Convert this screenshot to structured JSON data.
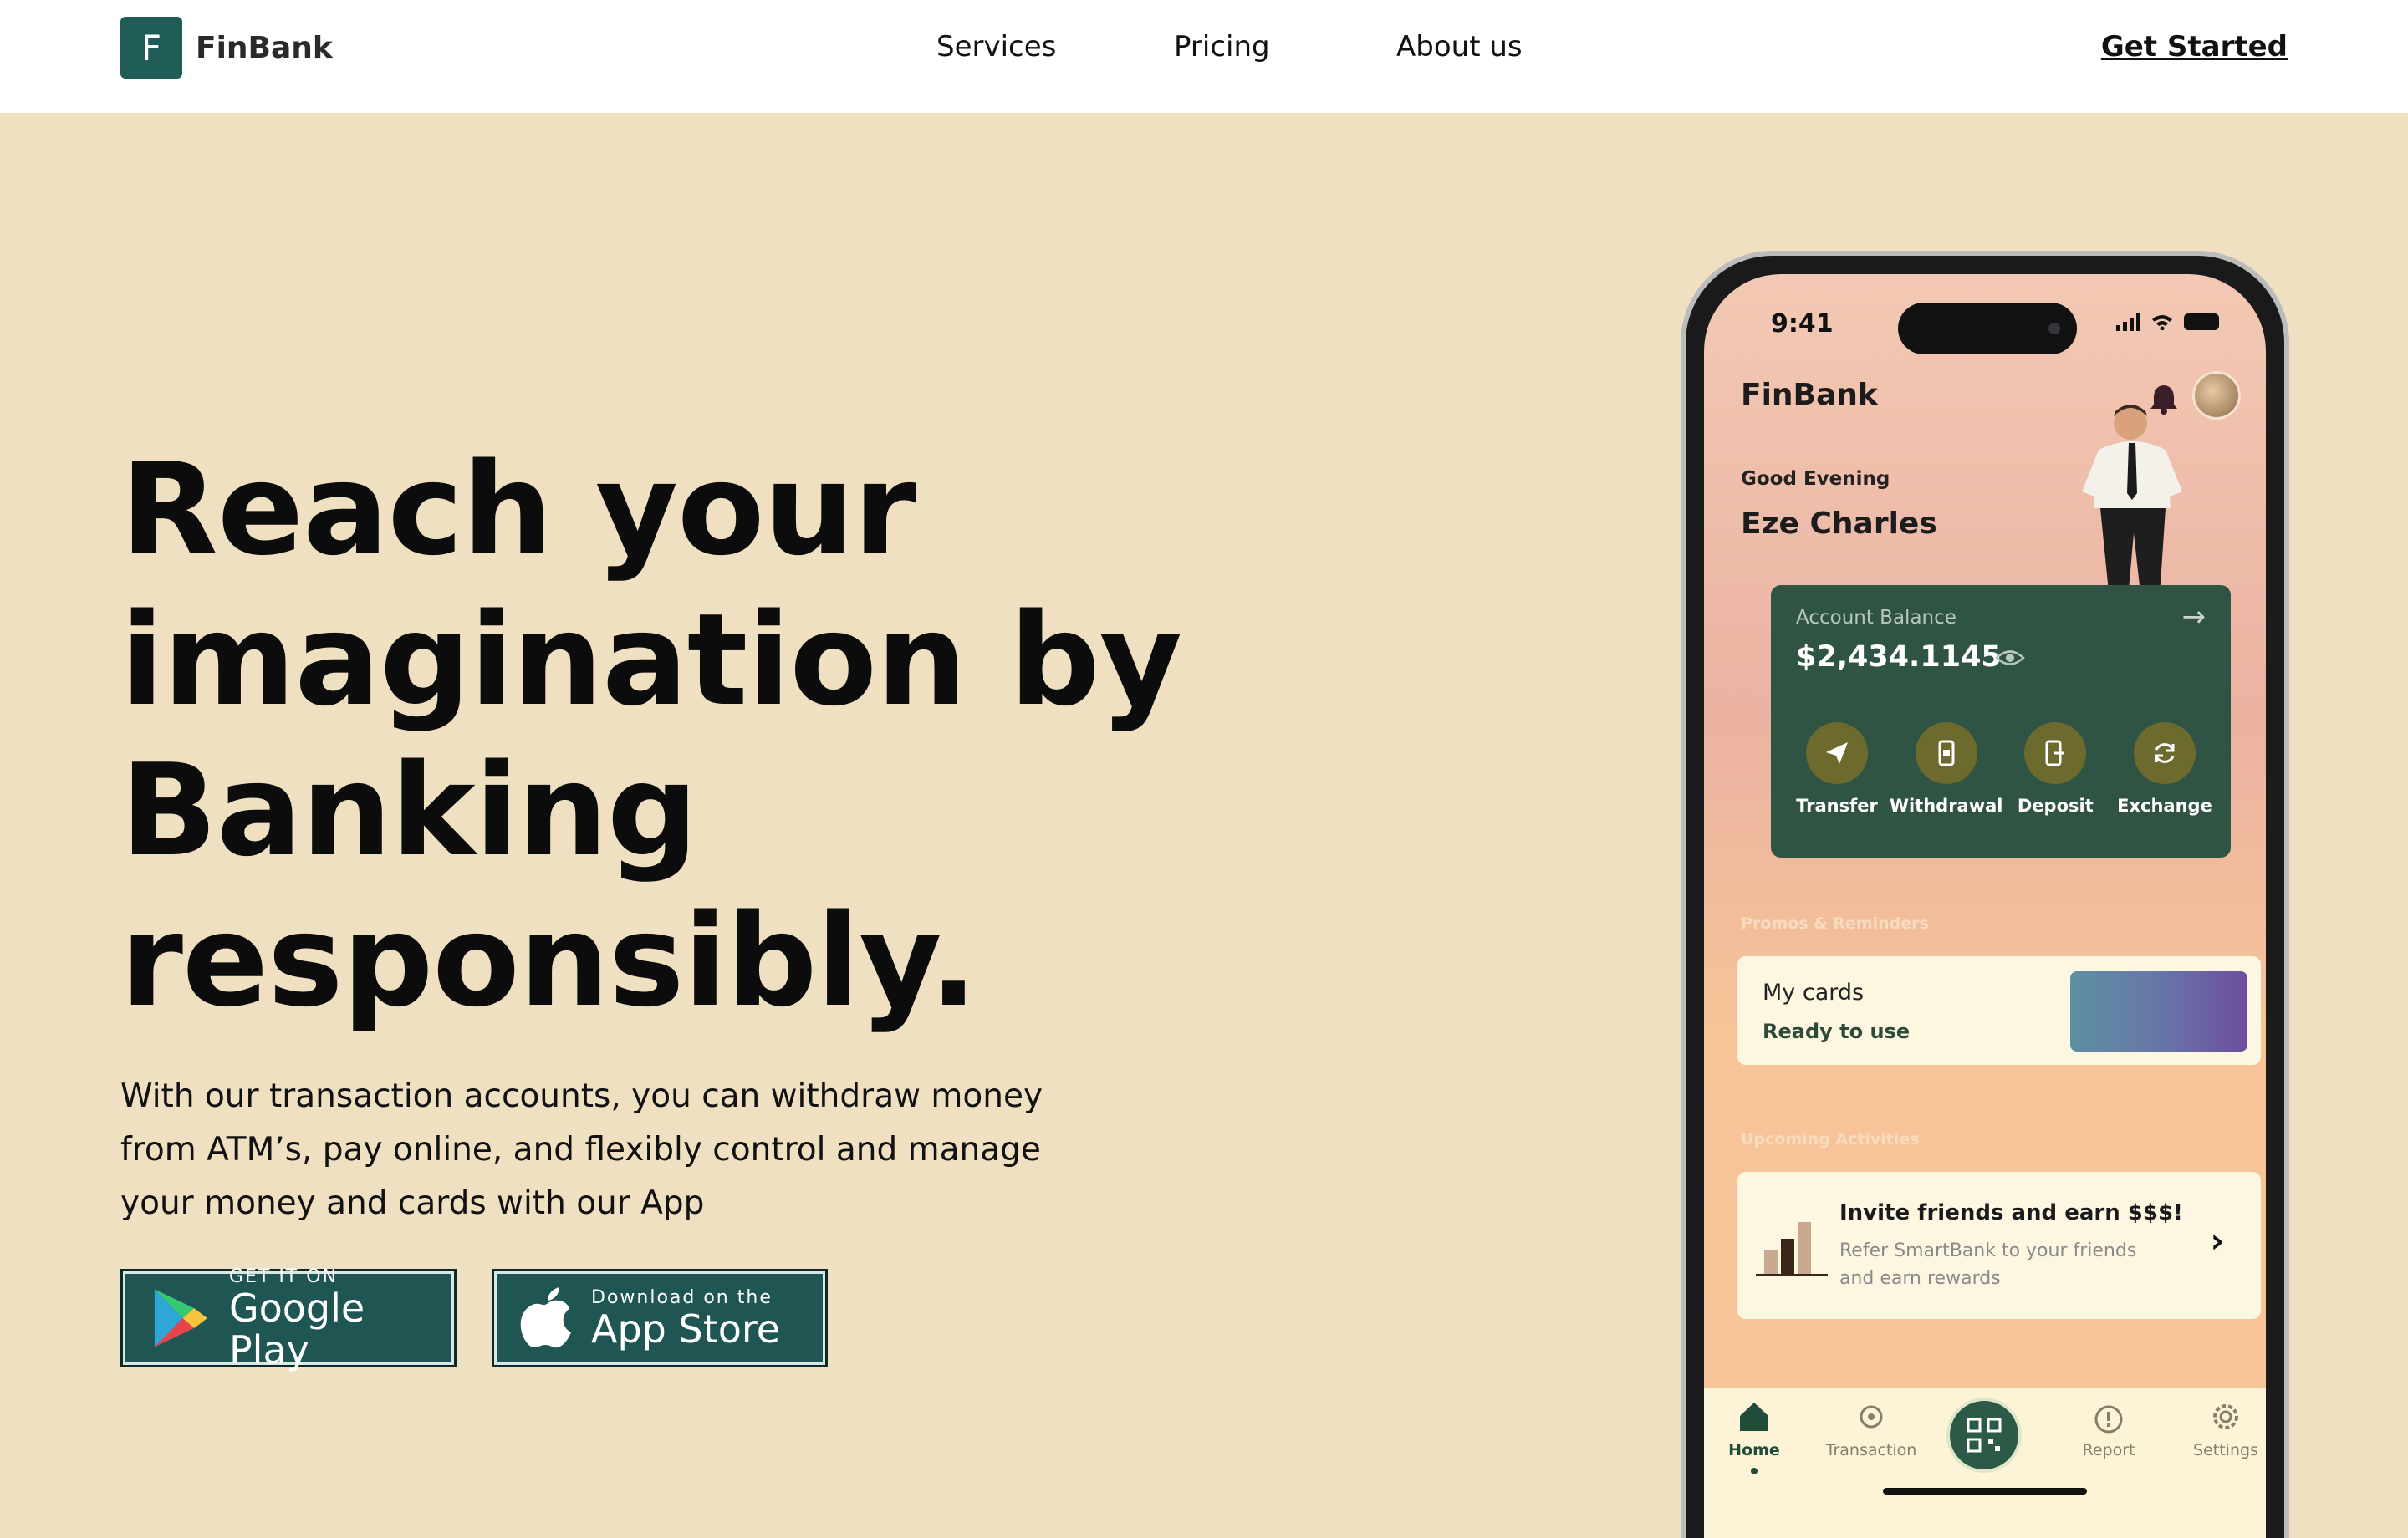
{
  "nav": {
    "logo_letter": "F",
    "logo_text": "FinBank",
    "links": [
      "Services",
      "Pricing",
      "About us"
    ],
    "cta": "Get Started"
  },
  "hero": {
    "headline_lines": [
      "Reach your",
      "imagination by",
      "Banking",
      "responsibly."
    ],
    "subtext_lines": [
      "With our transaction accounts, you can withdraw money",
      "from ATM’s, pay online, and flexibly control and manage",
      "your money and cards with our App"
    ],
    "google_play": {
      "small": "GET IT ON",
      "big": "Google Play"
    },
    "app_store": {
      "small": "Download on the",
      "big": "App Store"
    }
  },
  "phone": {
    "time": "9:41",
    "app_title": "FinBank",
    "greeting": "Good Evening",
    "user_name": "Eze Charles",
    "balance": {
      "label": "Account Balance",
      "value": "$2,434.1145",
      "actions": [
        "Transfer",
        "Withdrawal",
        "Deposit",
        "Exchange"
      ]
    },
    "promos_title": "Promos & Reminders",
    "my_cards": {
      "title": "My cards",
      "subtitle": "Ready to use"
    },
    "upcoming_title": "Upcoming Activities",
    "invite": {
      "title": "Invite friends and earn $$$!",
      "sub1": "Refer SmartBank to your friends",
      "sub2": "and earn rewards"
    },
    "tabs": [
      "Home",
      "Transaction",
      "Report",
      "Settings"
    ]
  },
  "colors": {
    "background": "#efe0c1",
    "brand_teal": "#1f5c58",
    "card_green": "#2f5444",
    "action_olive": "#6d6a2e"
  }
}
